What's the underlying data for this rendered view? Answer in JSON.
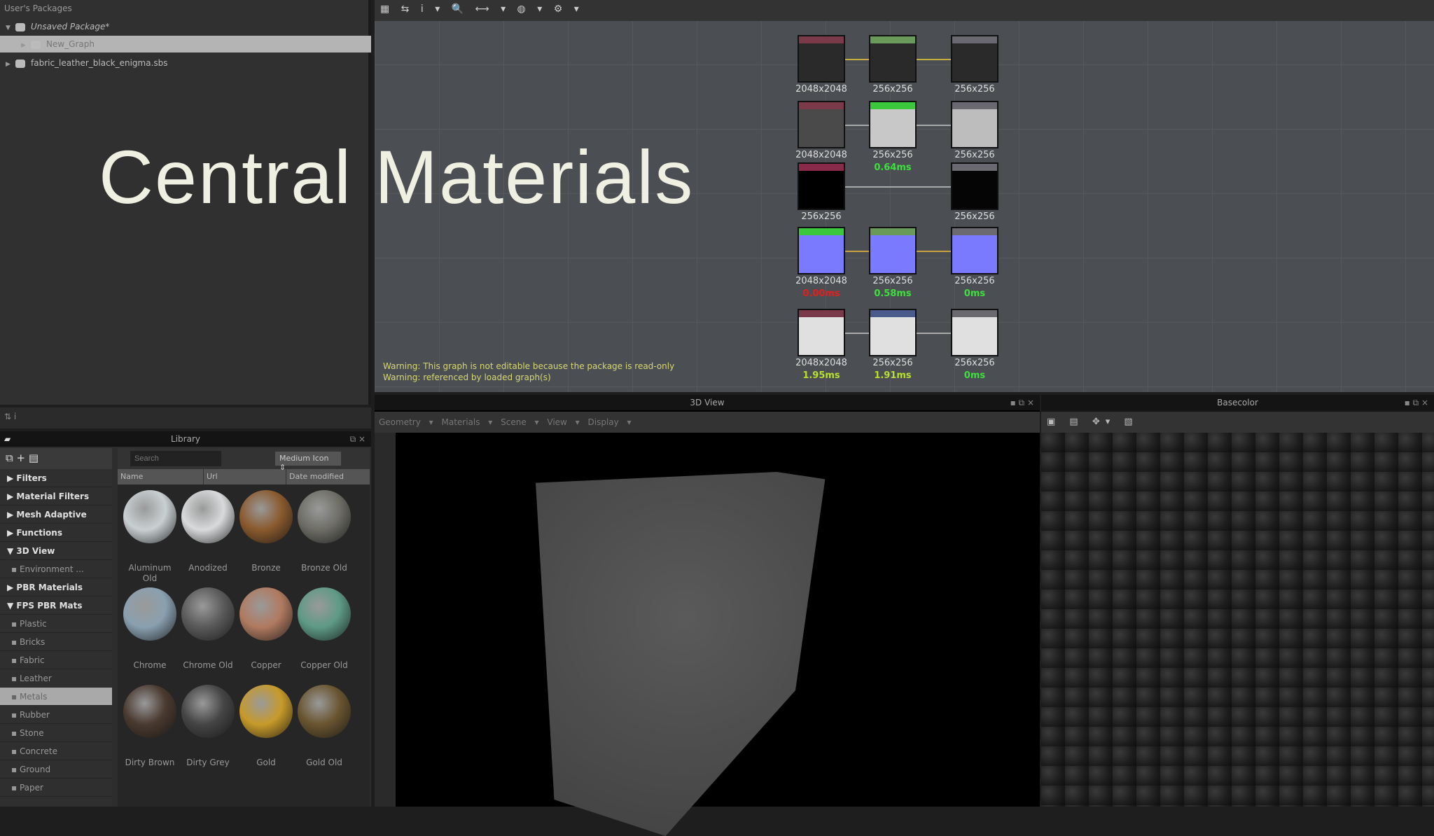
{
  "overlay_title": "Central Materials",
  "explorer": {
    "header": "User's Packages",
    "items": [
      {
        "label": "Unsaved Package*",
        "y": 26
      },
      {
        "label": "New_Graph",
        "y": 51,
        "selected": true
      },
      {
        "label": "fabric_leather_black_enigma.sbs",
        "y": 78
      }
    ]
  },
  "explorer_toolbar": "⇅ i",
  "library": {
    "title": "Library",
    "search_placeholder": "Search",
    "view_mode": "Medium Icon",
    "columns": [
      "Name",
      "Url",
      "Date modified"
    ],
    "categories": [
      {
        "label": "Filters"
      },
      {
        "label": "Material Filters"
      },
      {
        "label": "Mesh Adaptive"
      },
      {
        "label": "Functions"
      },
      {
        "label": "3D View",
        "open": true
      },
      {
        "label": "Environment ...",
        "sub": true
      },
      {
        "label": "PBR Materials"
      },
      {
        "label": "FPS PBR Mats",
        "open": true
      },
      {
        "label": "Plastic",
        "sub": true
      },
      {
        "label": "Bricks",
        "sub": true
      },
      {
        "label": "Fabric",
        "sub": true
      },
      {
        "label": "Leather",
        "sub": true
      },
      {
        "label": "Metals",
        "sub": true,
        "selected": true
      },
      {
        "label": "Rubber",
        "sub": true
      },
      {
        "label": "Stone",
        "sub": true
      },
      {
        "label": "Concrete",
        "sub": true
      },
      {
        "label": "Ground",
        "sub": true
      },
      {
        "label": "Paper",
        "sub": true
      }
    ],
    "materials": [
      {
        "name": "Aluminum Old",
        "color": "#c9d0d2"
      },
      {
        "name": "Anodized",
        "color": "#d8dadb"
      },
      {
        "name": "Bronze",
        "color": "#8a5a2e"
      },
      {
        "name": "Bronze Old",
        "color": "#6e6e66"
      },
      {
        "name": "Chrome",
        "color": "#8aa0b0"
      },
      {
        "name": "Chrome Old",
        "color": "#5a5a5a"
      },
      {
        "name": "Copper",
        "color": "#b07a60"
      },
      {
        "name": "Copper Old",
        "color": "#5e9a85"
      },
      {
        "name": "Dirty Brown",
        "color": "#4a3a30"
      },
      {
        "name": "Dirty Grey",
        "color": "#454545"
      },
      {
        "name": "Gold",
        "color": "#c79a2a"
      },
      {
        "name": "Gold Old",
        "color": "#6a5530"
      }
    ]
  },
  "graph": {
    "toolbar": "▦ ⇆ i ▾ 🔍 ⟷ ▾ ◍ ▾ ⚙ ▾",
    "warnings": [
      "Warning: This graph is not editable because the package is read-only",
      "Warning: referenced by loaded graph(s)"
    ],
    "nodes": [
      {
        "size": "2048x2048",
        "head": "#7a3a4a",
        "fill": "#2a2a2a",
        "col": 0,
        "row": 0
      },
      {
        "size": "256x256",
        "head": "#6a9a5a",
        "fill": "#2a2a2a",
        "col": 1,
        "row": 0
      },
      {
        "size": "256x256",
        "head": "#6a6a70",
        "fill": "#2a2a2a",
        "col": 2,
        "row": 0
      },
      {
        "size": "2048x2048",
        "head": "#7a3a4a",
        "fill": "#4a4a4a",
        "col": 0,
        "row": 1
      },
      {
        "size": "256x256",
        "head": "#3cc83c",
        "fill": "#c8c8c8",
        "col": 1,
        "row": 1,
        "time": "0.64ms",
        "tc": "#3ee03e"
      },
      {
        "size": "256x256",
        "head": "#6a6a70",
        "fill": "#bdbdbd",
        "col": 2,
        "row": 1
      },
      {
        "size": "256x256",
        "head": "#8a2a4a",
        "fill": "#000000",
        "col": 0,
        "row": 2
      },
      {
        "size": "256x256",
        "head": "#6a6a70",
        "fill": "#050505",
        "col": 2,
        "row": 2
      },
      {
        "size": "2048x2048",
        "head": "#3cc83c",
        "fill": "#7a7aff",
        "col": 0,
        "row": 3,
        "time": "0.00ms",
        "tc": "#e02020"
      },
      {
        "size": "256x256",
        "head": "#6a9a5a",
        "fill": "#7a7aff",
        "col": 1,
        "row": 3,
        "time": "0.58ms",
        "tc": "#3ee03e"
      },
      {
        "size": "256x256",
        "head": "#6a6a70",
        "fill": "#7a7aff",
        "col": 2,
        "row": 3,
        "time": "0ms",
        "tc": "#3ee03e"
      },
      {
        "size": "2048x2048",
        "head": "#7a3a4a",
        "fill": "#e0e0e0",
        "col": 0,
        "row": 4,
        "time": "1.95ms",
        "tc": "#b8e030"
      },
      {
        "size": "256x256",
        "head": "#4a5a8a",
        "fill": "#e0e0e0",
        "col": 1,
        "row": 4,
        "time": "1.91ms",
        "tc": "#b8e030"
      },
      {
        "size": "256x256",
        "head": "#6a6a70",
        "fill": "#e0e0e0",
        "col": 2,
        "row": 4,
        "time": "0ms",
        "tc": "#3ee03e"
      }
    ]
  },
  "view3d": {
    "title": "3D View",
    "menus": "Geometry ▾ Materials ▾ Scene ▾ View ▾ Display ▾"
  },
  "basecolor": {
    "title": "Basecolor",
    "toolbar": "▣ ▤ ✥▾ ▧"
  }
}
